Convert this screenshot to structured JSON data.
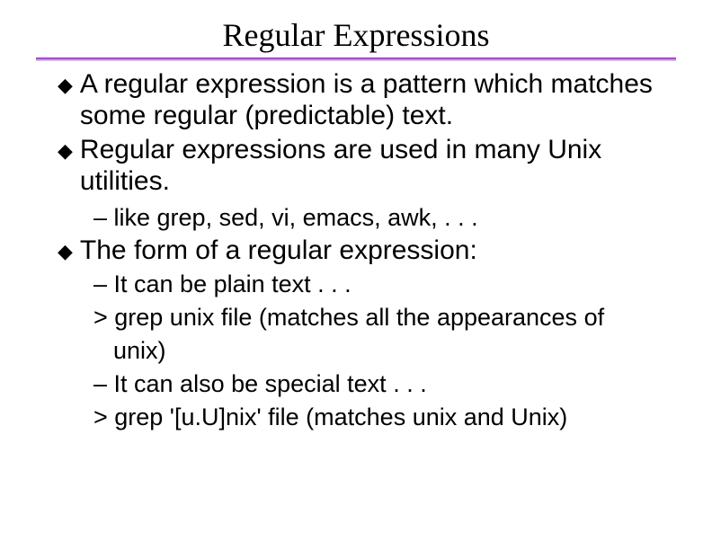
{
  "title": "Regular Expressions",
  "bullets": {
    "b1": "A regular expression is a pattern which matches some regular (predictable) text.",
    "b2": "Regular expressions are used in many Unix utilities.",
    "b2_sub1": "– like grep, sed, vi, emacs, awk, . . .",
    "b3": "The form of a regular expression:",
    "b3_sub1": "– It can be plain text . . .",
    "b3_sub2": "> grep unix file (matches all the appearances of",
    "b3_sub2b": "unix)",
    "b3_sub3": "– It can also be special text . . .",
    "b3_sub4": "> grep '[u.U]nix' file  (matches unix and Unix)"
  },
  "icons": {
    "diamond": "◆"
  }
}
